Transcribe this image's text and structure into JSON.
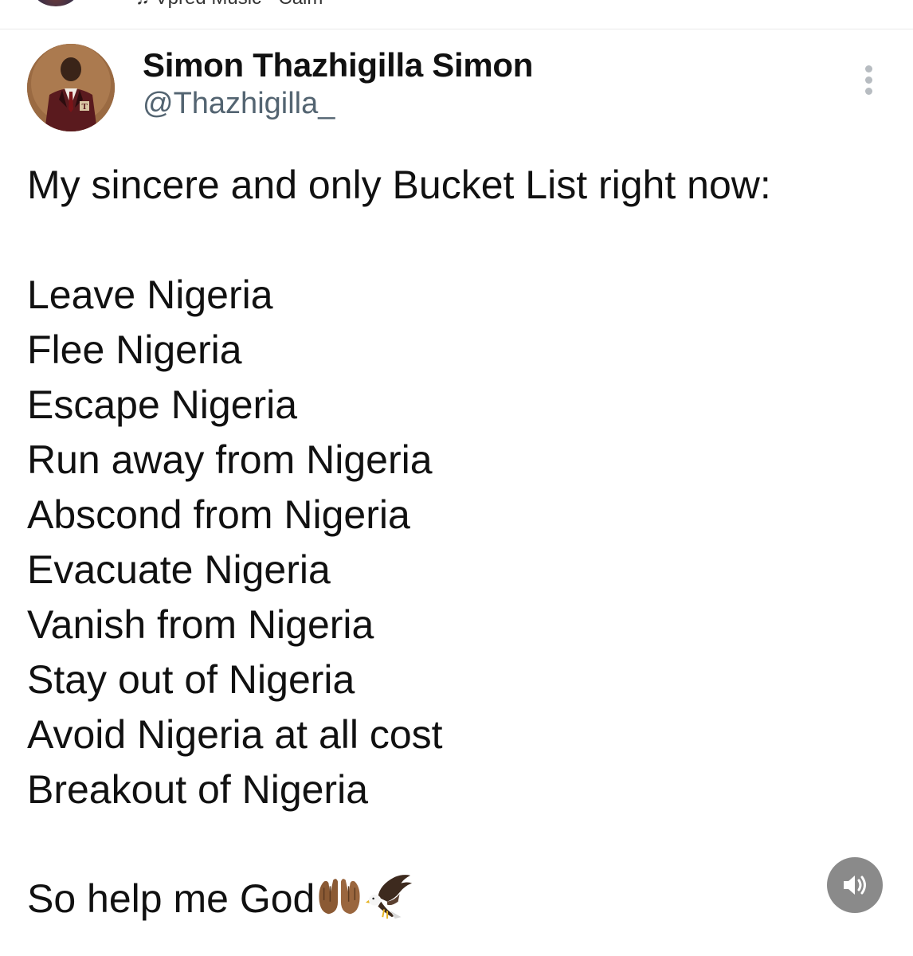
{
  "top_strip": {
    "partial_text": "♫ Vpred Music · Calm"
  },
  "tweet": {
    "author": {
      "display_name": "Simon Thazhigilla Simon",
      "handle": "@Thazhigilla_"
    },
    "intro": "My sincere and only Bucket List right now:",
    "list": [
      "Leave Nigeria",
      "Flee Nigeria",
      "Escape Nigeria",
      "Run away from Nigeria",
      "Abscond from Nigeria",
      "Evacuate Nigeria",
      "Vanish from Nigeria",
      "Stay out of Nigeria",
      "Avoid Nigeria at all cost",
      "Breakout of Nigeria"
    ],
    "closing": "So help me God",
    "closing_emojis": [
      "palms-up-together-icon",
      "eagle-icon"
    ]
  },
  "icons": {
    "more": "more-vertical-icon",
    "volume": "volume-icon"
  },
  "colors": {
    "handle": "#536471",
    "volume_bg": "#8a8a8a",
    "more_dots": "#b7bcc1"
  }
}
